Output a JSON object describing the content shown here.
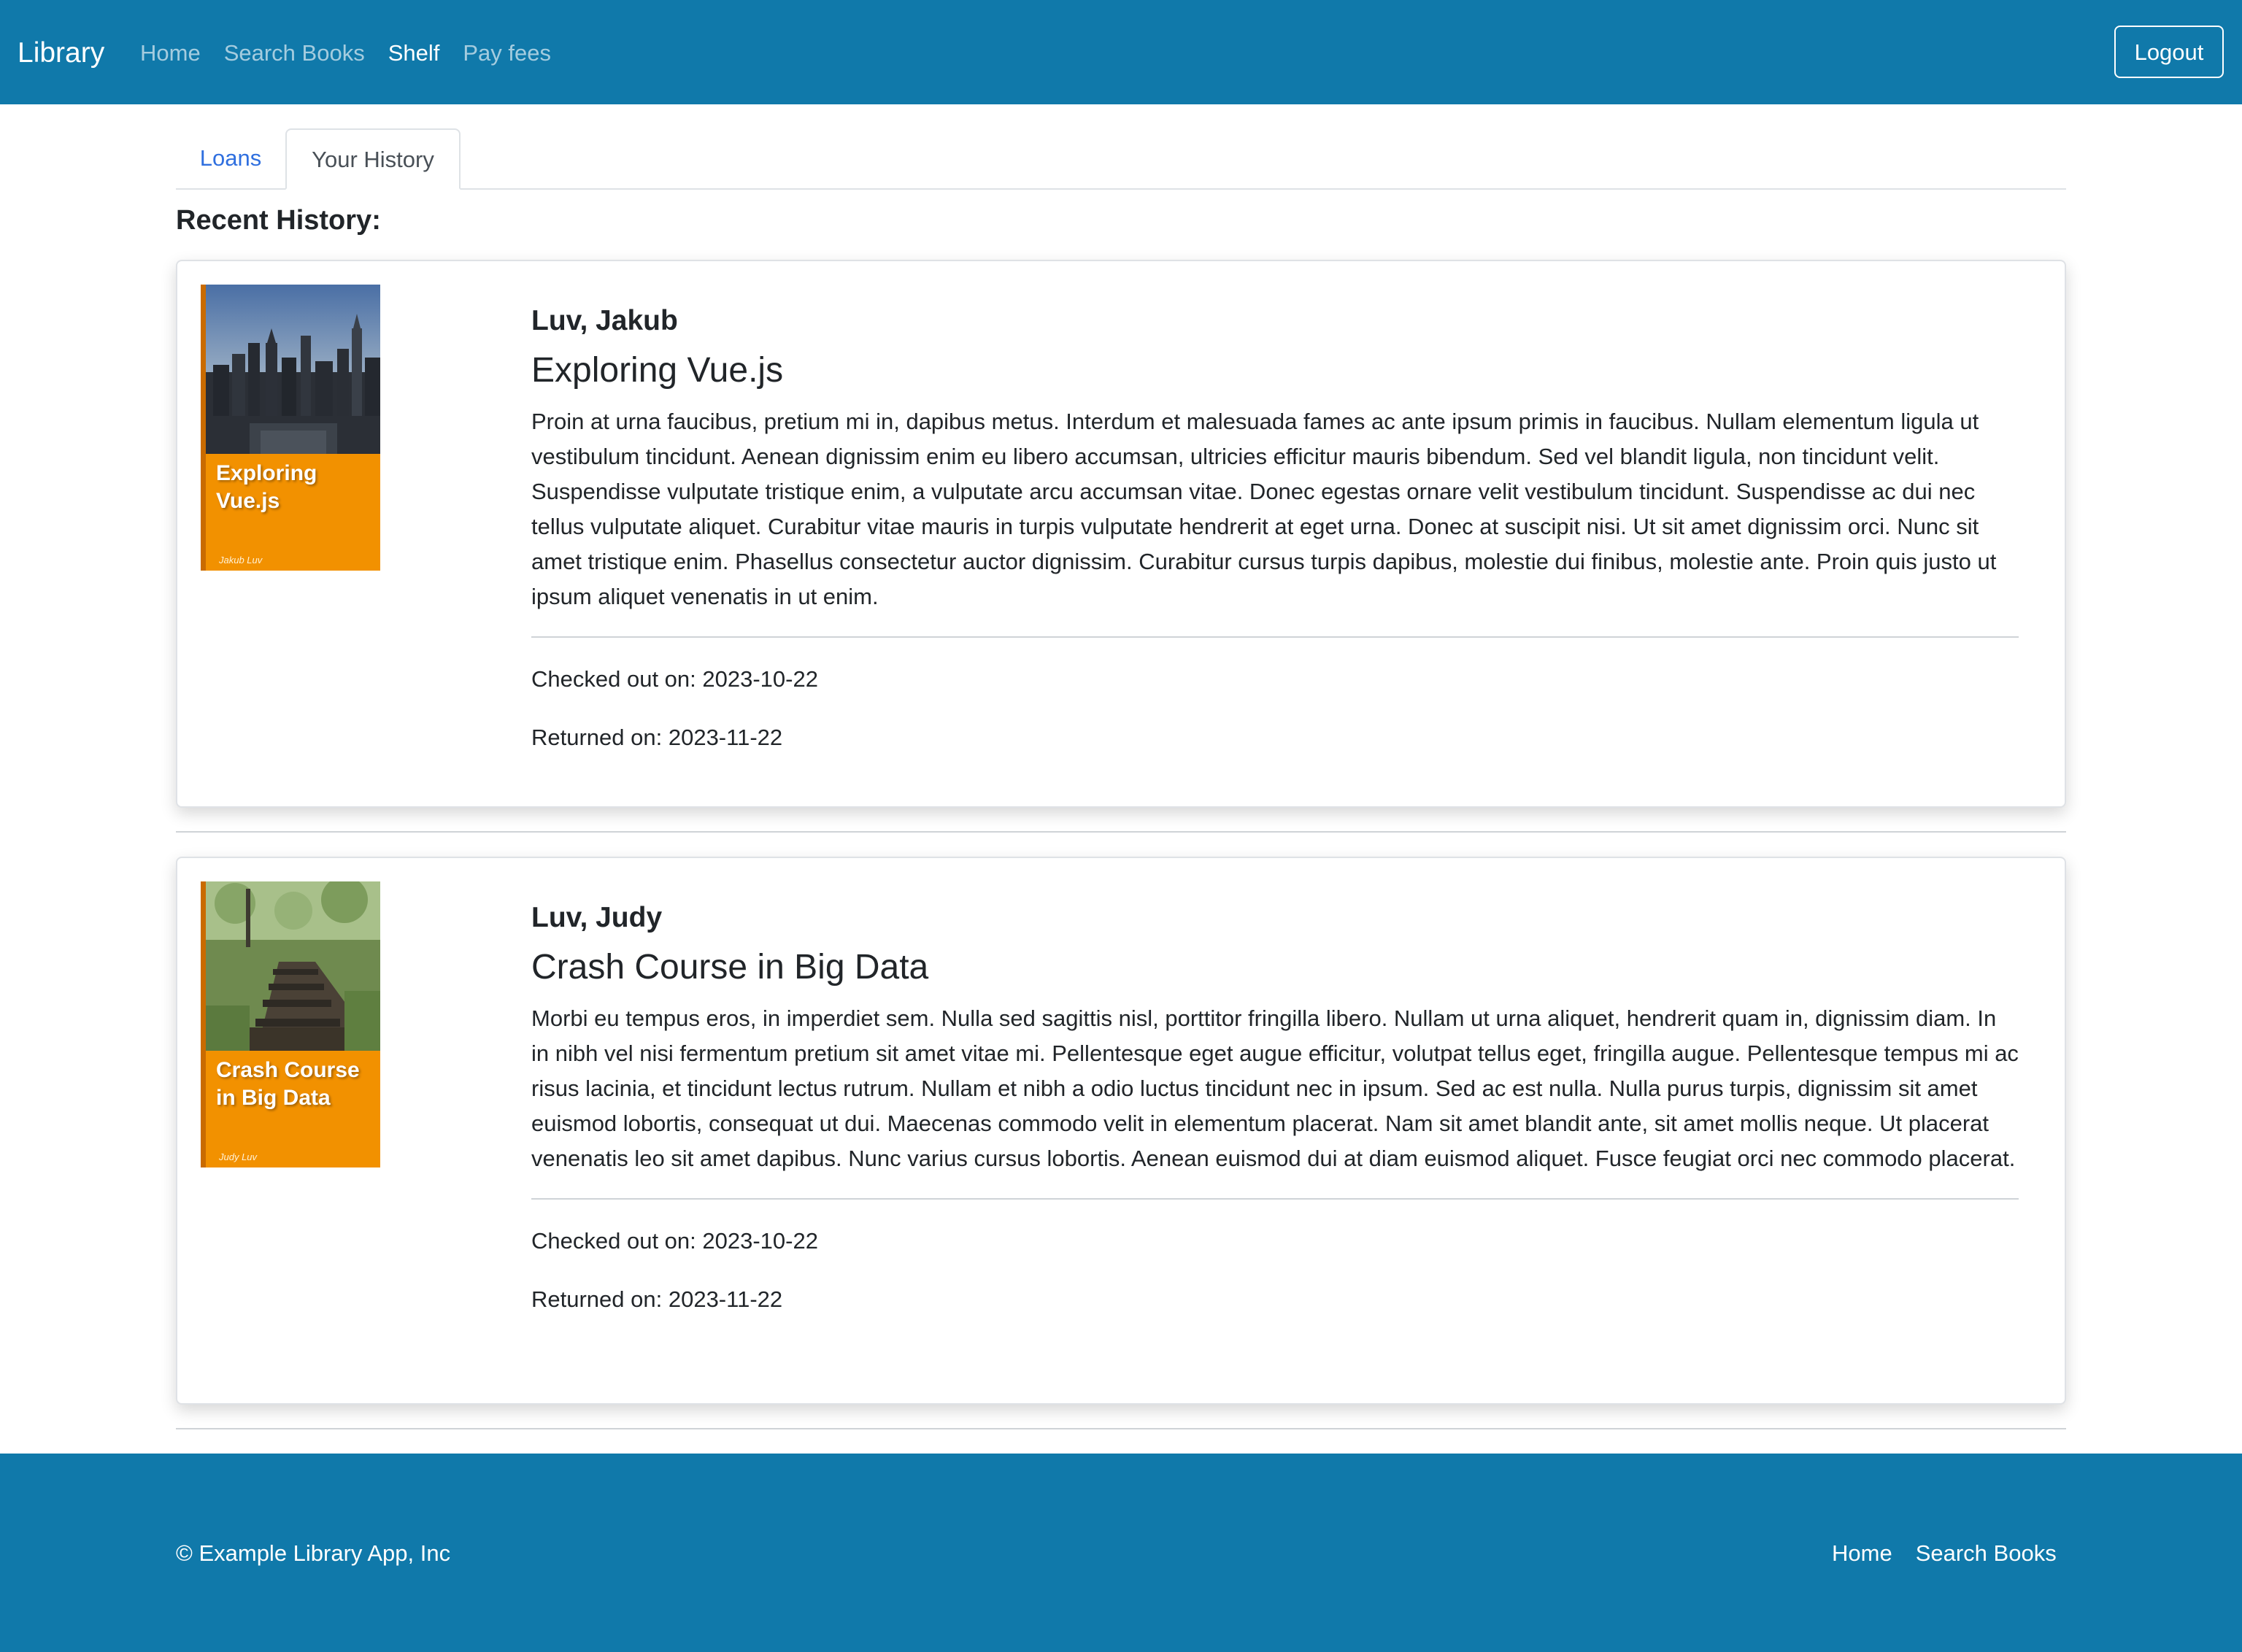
{
  "navbar": {
    "brand": "Library",
    "links": [
      "Home",
      "Search Books",
      "Shelf",
      "Pay fees"
    ],
    "active": "Shelf",
    "logout_label": "Logout",
    "bg_color": "#1079aa"
  },
  "tabs": [
    {
      "label": "Loans",
      "active": false
    },
    {
      "label": "Your History",
      "active": true
    }
  ],
  "section_title": "Recent History:",
  "history": [
    {
      "cover_title": "Exploring Vue.js",
      "cover_author": "Jakub Luv",
      "author": "Luv, Jakub",
      "title": "Exploring Vue.js",
      "description": "Proin at urna faucibus, pretium mi in, dapibus metus. Interdum et malesuada fames ac ante ipsum primis in faucibus. Nullam elementum ligula ut vestibulum tincidunt. Aenean dignissim enim eu libero accumsan, ultricies efficitur mauris bibendum. Sed vel blandit ligula, non tincidunt velit. Suspendisse vulputate tristique enim, a vulputate arcu accumsan vitae. Donec egestas ornare velit vestibulum tincidunt. Suspendisse ac dui nec tellus vulputate aliquet. Curabitur vitae mauris in turpis vulputate hendrerit at eget urna. Donec at suscipit nisi. Ut sit amet dignissim orci. Nunc sit amet tristique enim. Phasellus consectetur auctor dignissim. Curabitur cursus turpis dapibus, molestie dui finibus, molestie ante. Proin quis justo ut ipsum aliquet venenatis in ut enim.",
      "checked_out": "Checked out on: 2023-10-22",
      "returned": "Returned on: 2023-11-22"
    },
    {
      "cover_title": "Crash Course in Big Data",
      "cover_author": "Judy Luv",
      "author": "Luv, Judy",
      "title": "Crash Course in Big Data",
      "description": "Morbi eu tempus eros, in imperdiet sem. Nulla sed sagittis nisl, porttitor fringilla libero. Nullam ut urna aliquet, hendrerit quam in, dignissim diam. In in nibh vel nisi fermentum pretium sit amet vitae mi. Pellentesque eget augue efficitur, volutpat tellus eget, fringilla augue. Pellentesque tempus mi ac risus lacinia, et tincidunt lectus rutrum. Nullam et nibh a odio luctus tincidunt nec in ipsum. Sed ac est nulla. Nulla purus turpis, dignissim sit amet euismod lobortis, consequat ut dui. Maecenas commodo velit in elementum placerat. Nam sit amet blandit ante, sit amet mollis neque. Ut placerat venenatis leo sit amet dapibus. Nunc varius cursus lobortis. Aenean euismod dui at diam euismod aliquet. Fusce feugiat orci nec commodo placerat.",
      "checked_out": "Checked out on: 2023-10-22",
      "returned": "Returned on: 2023-11-22"
    }
  ],
  "footer": {
    "copyright": "© Example Library App, Inc",
    "links": [
      "Home",
      "Search Books"
    ]
  }
}
